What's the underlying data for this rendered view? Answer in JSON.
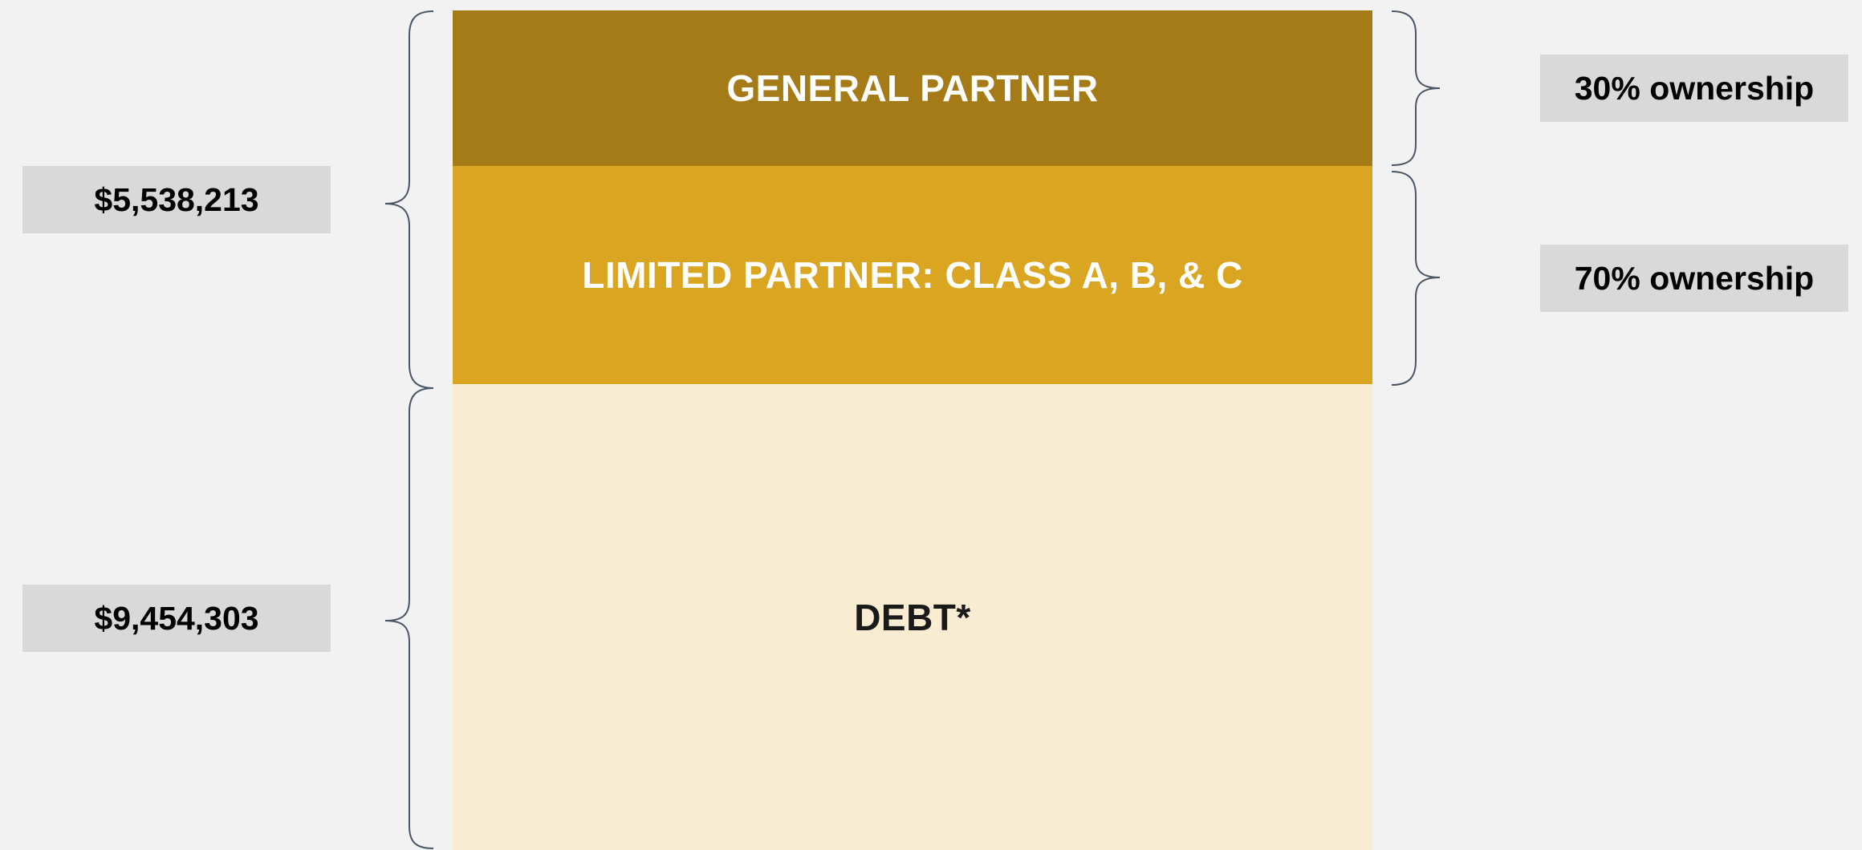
{
  "colors": {
    "background": "#f2f2f2",
    "general_partner": "#a47b17",
    "limited_partner": "#daa622",
    "debt": "#f8edd2",
    "label_box": "#d9d9d9",
    "brace": "#4a5565",
    "light_text": "#ffffff",
    "dark_text": "#1a1a1a"
  },
  "layers": {
    "general_partner": {
      "label": "GENERAL PARTNER"
    },
    "limited_partner": {
      "label": "LIMITED PARTNER: CLASS A, B, & C"
    },
    "debt": {
      "label": "DEBT*"
    }
  },
  "amounts": {
    "equity_total": "$5,538,213",
    "debt_total": "$9,454,303"
  },
  "ownership": {
    "general_partner": "30% ownership",
    "limited_partner": "70% ownership"
  }
}
